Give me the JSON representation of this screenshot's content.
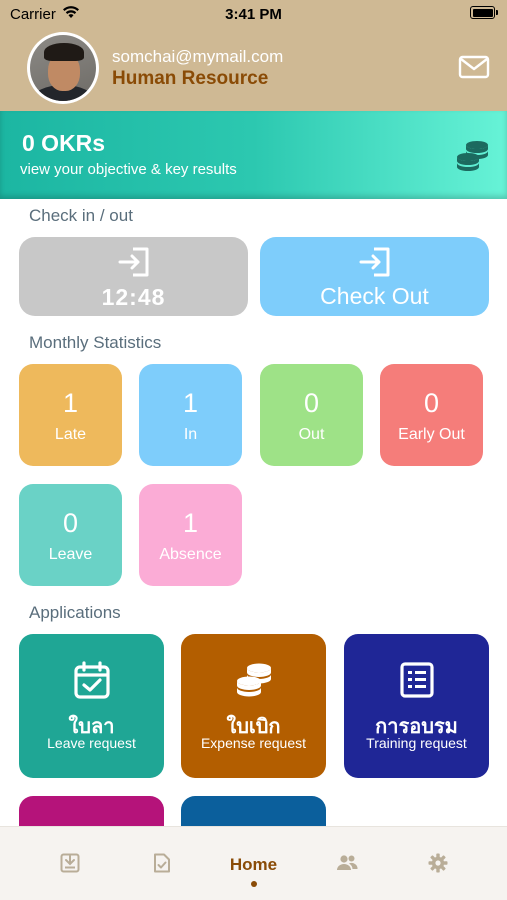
{
  "status_bar": {
    "carrier": "Carrier",
    "time": "3:41 PM"
  },
  "profile": {
    "email": "somchai@mymail.com",
    "department": "Human Resource"
  },
  "okr": {
    "title": "0 OKRs",
    "subtitle": "view your objective & key results"
  },
  "check": {
    "section_title": "Check in / out",
    "checkin_time": "12:48",
    "checkout_label": "Check Out"
  },
  "monthly": {
    "section_title": "Monthly Statistics",
    "stats": [
      {
        "value": "1",
        "label": "Late",
        "color": "#eeb95c"
      },
      {
        "value": "1",
        "label": "In",
        "color": "#7ecdfb"
      },
      {
        "value": "0",
        "label": "Out",
        "color": "#9ee287"
      },
      {
        "value": "0",
        "label": "Early Out",
        "color": "#f57d7a"
      },
      {
        "value": "0",
        "label": "Leave",
        "color": "#6ad2c6"
      },
      {
        "value": "1",
        "label": "Absence",
        "color": "#fbacd6"
      }
    ]
  },
  "applications": {
    "section_title": "Applications",
    "items": [
      {
        "title_th": "ใบลา",
        "title_en": "Leave request",
        "color": "#1fa695",
        "icon": "calendar-check-icon"
      },
      {
        "title_th": "ใบเบิก",
        "title_en": "Expense request",
        "color": "#b35e00",
        "icon": "coins-icon"
      },
      {
        "title_th": "การอบรม",
        "title_en": "Training request",
        "color": "#1f2696",
        "icon": "list-icon"
      }
    ],
    "partial_colors": [
      "#b5137a",
      "#0b5f9c"
    ]
  },
  "tabbar": {
    "tabs": [
      {
        "name": "download-icon"
      },
      {
        "name": "document-check-icon"
      },
      {
        "label": "Home"
      },
      {
        "name": "users-icon"
      },
      {
        "name": "gear-icon"
      }
    ]
  },
  "colors": {
    "header": "#cfb994",
    "accent": "#8a4b06",
    "inactive_icon": "#b9ad98"
  }
}
